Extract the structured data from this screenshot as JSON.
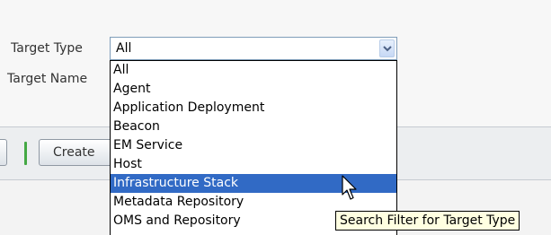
{
  "filters": {
    "target_type_label": "Target Type",
    "target_name_label": "Target Name",
    "target_type_value": "All"
  },
  "dropdown": {
    "options": [
      "All",
      "Agent",
      "Application Deployment",
      "Beacon",
      "EM Service",
      "Host",
      "Infrastructure Stack",
      "Metadata Repository",
      "OMS and Repository"
    ],
    "highlighted": "Infrastructure Stack"
  },
  "toolbar": {
    "create_label": "Create"
  },
  "tooltip": {
    "text": "Search Filter for Target Type"
  },
  "colors": {
    "selection": "#316ac5",
    "tooltip_bg": "#ffffe1",
    "separator": "#44a844"
  }
}
